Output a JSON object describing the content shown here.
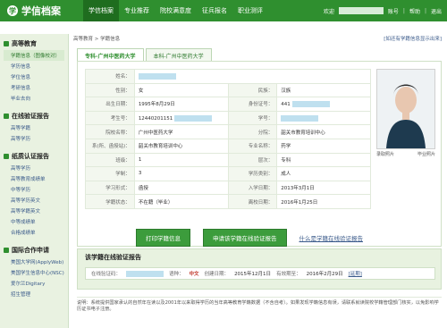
{
  "header": {
    "logo_text": "学信档案",
    "tabs": [
      "学信档案",
      "专业推荐",
      "院校满意度",
      "征兵报名",
      "职业测评"
    ],
    "welcome": "欢迎",
    "account_suffix": "账号",
    "help": "帮助",
    "logout": "退出",
    "colors": {
      "brand": "#2f8f2f"
    }
  },
  "sidebar": {
    "sections": [
      {
        "title": "高等教育",
        "items": [
          "学籍信息（图像校对）",
          "学历信息",
          "学位信息",
          "考研信息",
          "毕业去向"
        ]
      },
      {
        "title": "在线验证报告",
        "items": [
          "高等学籍",
          "高等学历"
        ]
      },
      {
        "title": "纸质认证报告",
        "items": [
          "高等学历",
          "高等教育成绩单",
          "中等学历",
          "高等学历英文",
          "高等学籍英文",
          "中等成绩单",
          "合格成绩单"
        ]
      },
      {
        "title": "国际合作申请",
        "items": [
          "美国大学网(ApplyWeb)",
          "美国学生信息中心(NSC)",
          "爱尔兰Digitary",
          "招生管理"
        ]
      }
    ]
  },
  "main": {
    "breadcrumb": "高等教育 > 学籍信息",
    "breadcrumb_right": "[如还有学籍信息显示出来]",
    "school_tabs": [
      "专科-广州中医药大学",
      "本科-广州中医药大学"
    ],
    "rows": [
      {
        "label": "姓名：",
        "value": "",
        "label2": "",
        "value2": ""
      },
      {
        "label": "性别：",
        "value": "女",
        "label2": "民族：",
        "value2": "汉族"
      },
      {
        "label": "出生日期：",
        "value": "1995年8月29日",
        "label2": "身份证号：",
        "value2": "441"
      },
      {
        "label": "考生号：",
        "value": "12440201151",
        "label2": "学号：",
        "value2": ""
      },
      {
        "label": "院校名称：",
        "value": "广州中医药大学",
        "label2": "分院：",
        "value2": "韶关市教育培训中心"
      },
      {
        "label": "系(所、函授站)：",
        "value": "韶关市教育培训中心",
        "label2": "专业名称：",
        "value2": "药学"
      },
      {
        "label": "班级：",
        "value": "1",
        "label2": "层次：",
        "value2": "专科"
      },
      {
        "label": "学制：",
        "value": "3",
        "label2": "学历类别：",
        "value2": "成人"
      },
      {
        "label": "学习形式：",
        "value": "函授",
        "label2": "入学日期：",
        "value2": "2013年3月1日"
      },
      {
        "label": "学籍状态：",
        "value": "不在籍（毕业）",
        "label2": "离校日期：",
        "value2": "2016年1月25日"
      }
    ],
    "photo_caption_left": "录取照片",
    "photo_caption_right": "毕业照片",
    "buttons": {
      "print": "打印学籍信息",
      "apply": "申请该学籍在线验证报告",
      "what_is": "什么是学籍在线验证报告"
    },
    "report": {
      "title": "该学籍在线验证报告",
      "code_label": "在线验证码：",
      "lang_label": "语种：",
      "lang_value": "中文",
      "created_label": "创建日期：",
      "created_value": "2015年12月1日",
      "valid_label": "有效期至：",
      "valid_value": "2016年2月29日",
      "extend": "[延期]"
    },
    "note": "说明：系统提供国家承认的自然年在读以及2001年以来取得学历的当年高等教育学籍数据（不含自考）。如果发现学籍信息有误，请联系就读院校学籍管理部门核实，以免影响学历证书电子注册。"
  }
}
